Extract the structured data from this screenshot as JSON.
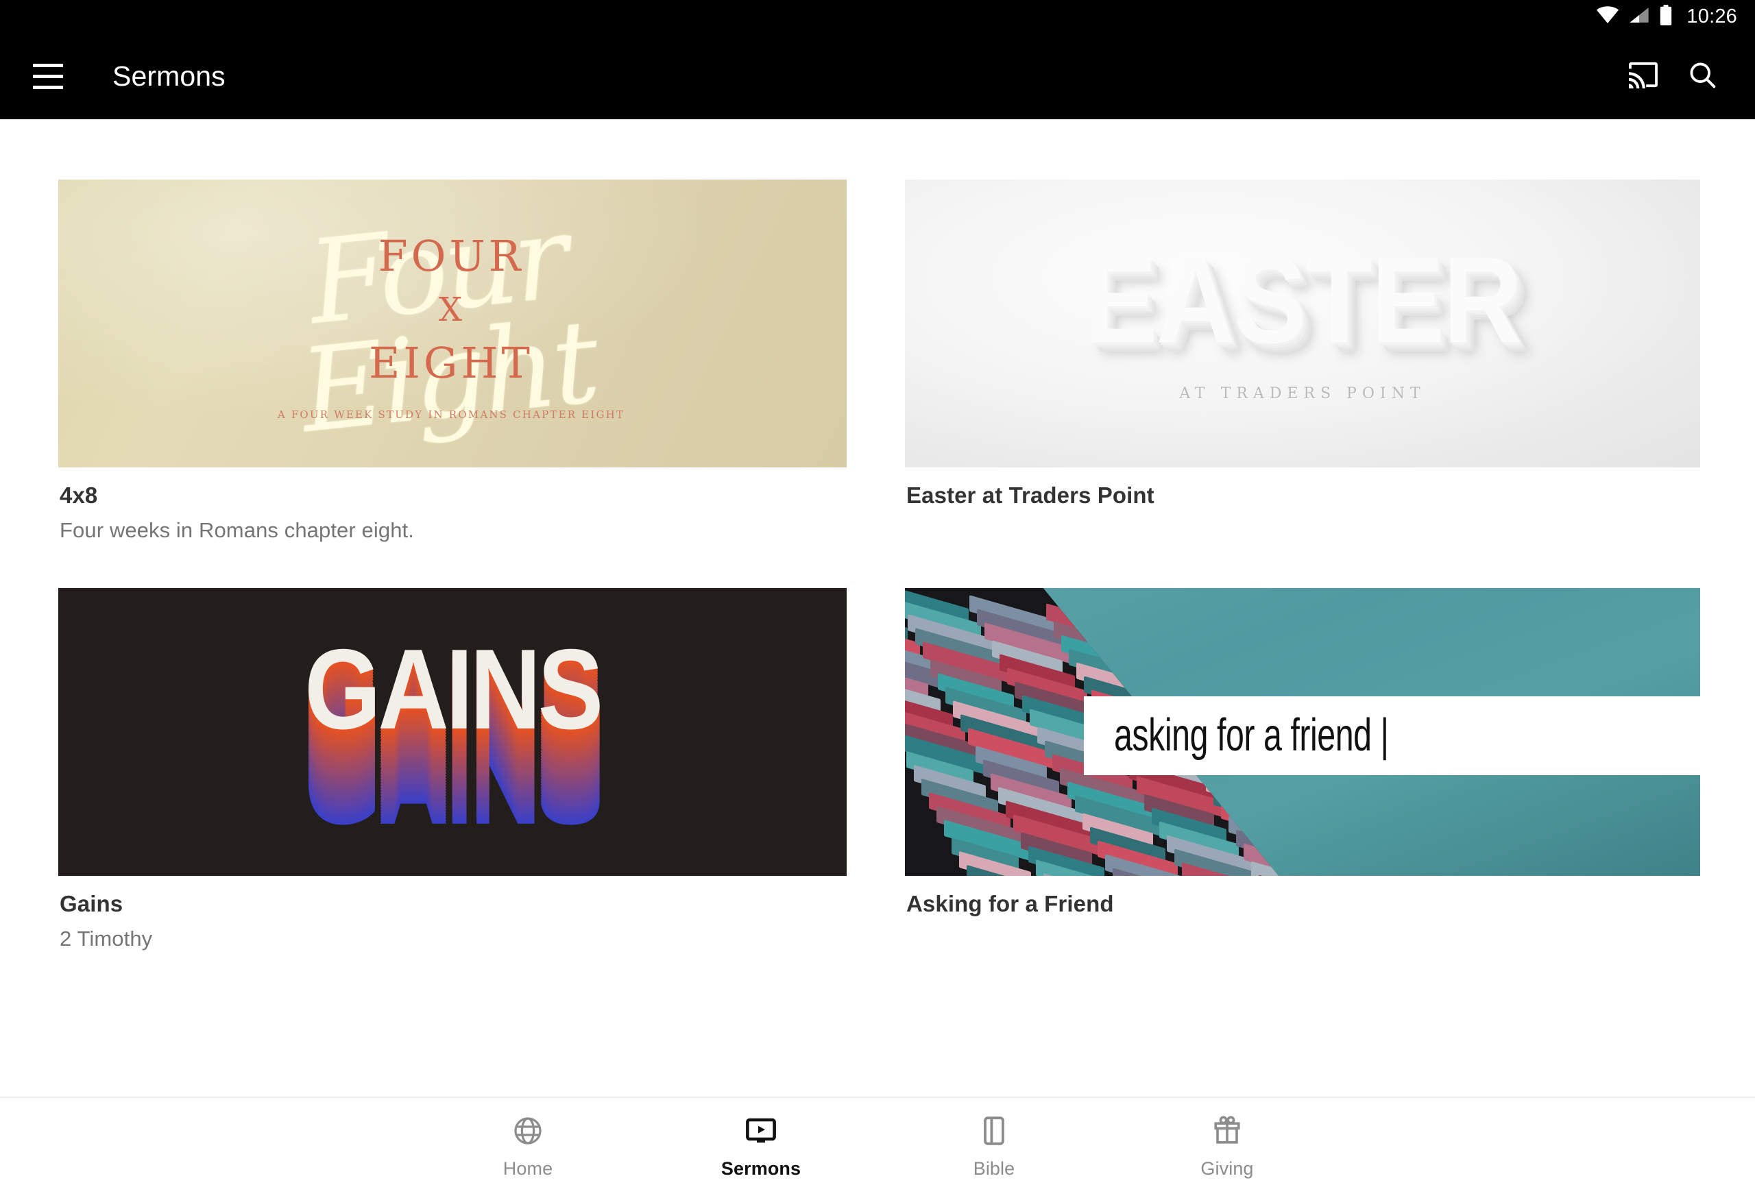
{
  "status_bar": {
    "time": "10:26",
    "icons": [
      "wifi-icon",
      "cellular-signal-icon",
      "battery-icon"
    ]
  },
  "app_bar": {
    "menu_icon": "hamburger-menu-icon",
    "title": "Sermons",
    "actions": [
      {
        "icon": "cast-icon",
        "label": "Cast"
      },
      {
        "icon": "search-icon",
        "label": "Search"
      }
    ]
  },
  "series": [
    {
      "title": "4x8",
      "subtitle": "Four weeks in Romans chapter eight.",
      "artwork": {
        "style": "four-x-eight",
        "script_text": "Four\nEight",
        "main_lines": [
          "FOUR",
          "X",
          "EIGHT"
        ],
        "tagline": "A FOUR WEEK STUDY IN ROMANS CHAPTER EIGHT",
        "bg_color": "#ded5ab",
        "text_color": "#d4694e"
      }
    },
    {
      "title": "Easter at Traders Point",
      "subtitle": "",
      "artwork": {
        "style": "easter",
        "word": "EASTER",
        "sub": "AT TRADERS POINT",
        "bg_color": "#f0f0f0",
        "text_color": "#fbfbfb"
      }
    },
    {
      "title": "Gains",
      "subtitle": "2 Timothy",
      "artwork": {
        "style": "gains",
        "word": "GAINS",
        "bg_color": "#231d1b",
        "text_color": "#f2efe9",
        "gradient_top": "#e8521f",
        "gradient_bottom": "#3b3fc8"
      }
    },
    {
      "title": "Asking for a Friend",
      "subtitle": "",
      "artwork": {
        "style": "asking-for-a-friend",
        "band_text": "asking for a friend |",
        "bg_color": "#4f9aa0",
        "band_color": "#ffffff"
      }
    }
  ],
  "bottom_nav": {
    "items": [
      {
        "label": "Home",
        "icon": "globe-icon",
        "active": false
      },
      {
        "label": "Sermons",
        "icon": "video-screen-icon",
        "active": true
      },
      {
        "label": "Bible",
        "icon": "book-icon",
        "active": false
      },
      {
        "label": "Giving",
        "icon": "gift-icon",
        "active": false
      }
    ]
  }
}
